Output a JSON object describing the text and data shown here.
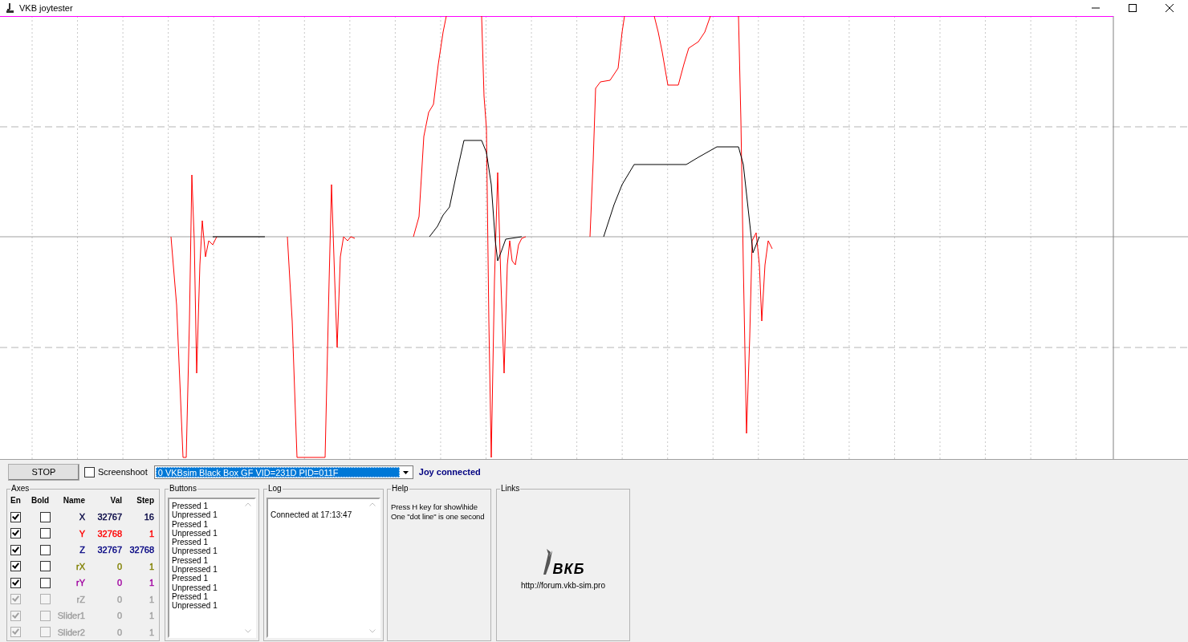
{
  "window": {
    "title": "VKB joytester"
  },
  "toolbar": {
    "stop_button": "STOP",
    "screenshot": {
      "label": "Screenshoot",
      "checked": false
    },
    "device": {
      "value": "0 VKBsim Black Box GF  VID=231D PID=011F"
    },
    "status": "Joy connected"
  },
  "axes": {
    "title": "Axes",
    "columns": [
      "En",
      "Bold",
      "Name",
      "Val",
      "Step"
    ],
    "rows": [
      {
        "en": true,
        "bold": false,
        "name": "X",
        "val": "32767",
        "step": "16",
        "color": "#000040",
        "disabled": false
      },
      {
        "en": true,
        "bold": false,
        "name": "Y",
        "val": "32768",
        "step": "1",
        "color": "#ff0000",
        "disabled": false
      },
      {
        "en": true,
        "bold": false,
        "name": "Z",
        "val": "32767",
        "step": "32768",
        "color": "#000080",
        "disabled": false
      },
      {
        "en": true,
        "bold": false,
        "name": "rX",
        "val": "0",
        "step": "1",
        "color": "#808000",
        "disabled": false
      },
      {
        "en": true,
        "bold": false,
        "name": "rY",
        "val": "0",
        "step": "1",
        "color": "#a000a0",
        "disabled": false
      },
      {
        "en": true,
        "bold": false,
        "name": "rZ",
        "val": "0",
        "step": "1",
        "color": "#a0a0a0",
        "disabled": true
      },
      {
        "en": true,
        "bold": false,
        "name": "Slider1",
        "val": "0",
        "step": "1",
        "color": "#a0a0a0",
        "disabled": true
      },
      {
        "en": true,
        "bold": false,
        "name": "Slider2",
        "val": "0",
        "step": "1",
        "color": "#a0a0a0",
        "disabled": true
      }
    ]
  },
  "buttons_panel": {
    "title": "Buttons",
    "entries": [
      "Pressed 1",
      "Unpressed 1",
      "Pressed 1",
      "Unpressed 1",
      "Pressed 1",
      "Unpressed 1",
      "Pressed 1",
      "Unpressed 1",
      "Pressed 1",
      "Unpressed 1",
      "Pressed 1",
      "Unpressed 1"
    ]
  },
  "log_panel": {
    "title": "Log",
    "entries": [
      "Connected at 17:13:47"
    ]
  },
  "help_panel": {
    "title": "Help",
    "lines": [
      "Press H key for show\\hide",
      "One \"dot line\" is one second"
    ]
  },
  "links_panel": {
    "title": "Links",
    "logo_text": "ВКБ",
    "url": "http://forum.vkb-sim.pro"
  }
}
